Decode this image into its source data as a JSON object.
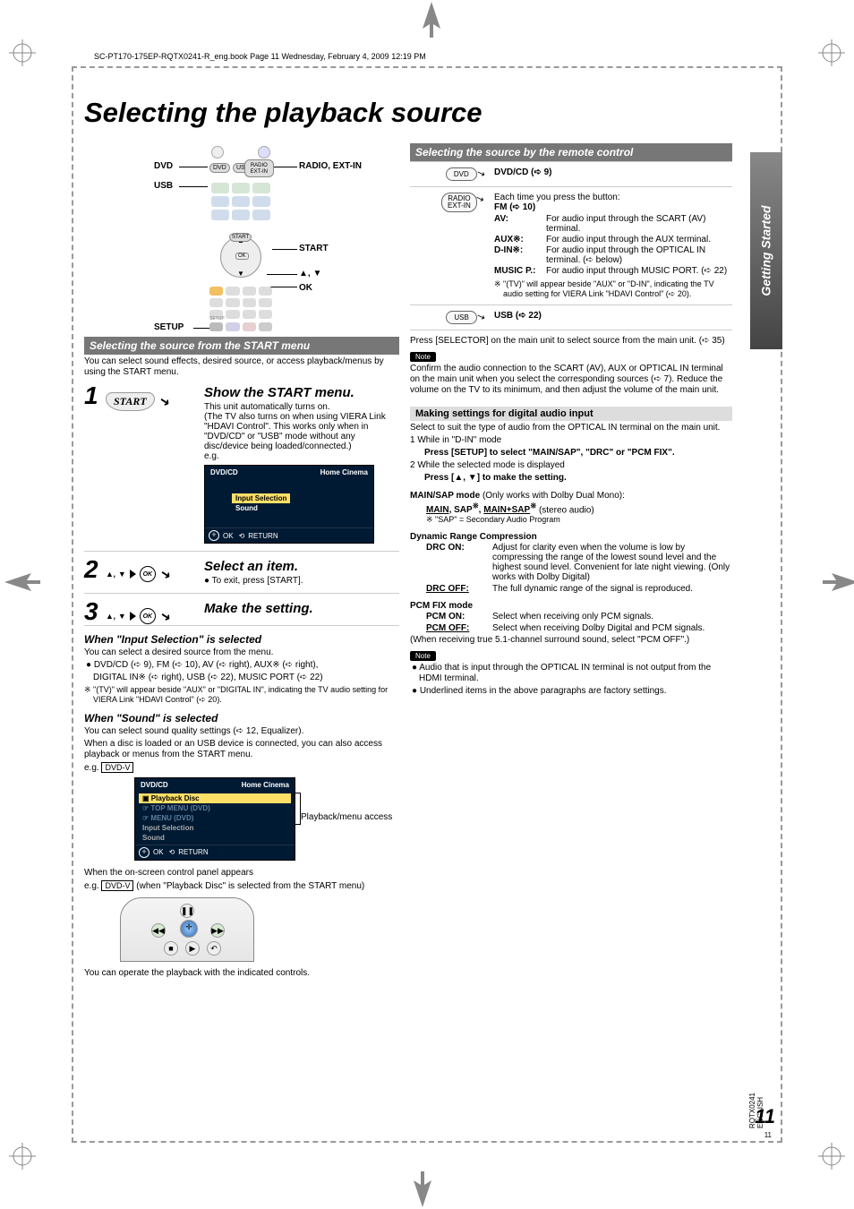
{
  "header_info": "SC-PT170-175EP-RQTX0241-R_eng.book  Page 11  Wednesday, February 4, 2009  12:19 PM",
  "page_title": "Selecting the playback source",
  "side_tab": "Getting Started",
  "remote_labels": {
    "dvd": "DVD",
    "usb": "USB",
    "radio_extin": "RADIO, EXT-IN",
    "start": "START",
    "updown": "▲, ▼",
    "ok": "OK",
    "setup": "SETUP",
    "btns": {
      "dvd": "DVD",
      "usb": "USB",
      "radio": "RADIO",
      "extin": "EXT-IN",
      "start": "START",
      "ok": "OK",
      "setup": "SETUP"
    }
  },
  "left": {
    "bar": "Selecting the source from the START menu",
    "intro": "You can select sound effects, desired source, or access playback/menus by using the START menu.",
    "step1": {
      "title": "Show the START menu.",
      "desc": "This unit automatically turns on.\n(The TV also turns on when using VIERA Link \"HDAVI Control\". This works only when in \"DVD/CD\" or \"USB\" mode without any disc/device being loaded/connected.)\ne.g.",
      "screen": {
        "dvdcd": "DVD/CD",
        "hc": "Home Cinema",
        "sel": "Input Selection",
        "sound": "Sound",
        "ok": "OK",
        "ret": "RETURN"
      }
    },
    "step2": {
      "icons": "▲, ▼",
      "ok": "OK",
      "title": "Select an item.",
      "desc": "● To exit, press [START]."
    },
    "step3": {
      "icons": "▲, ▼",
      "ok": "OK",
      "title": "Make the setting."
    },
    "input_sel": {
      "head": "When \"Input Selection\" is selected",
      "p1": "You can select a desired source from the menu.",
      "b1": "DVD/CD (➪ 9), FM (➪ 10), AV (➪ right), AUX※ (➪ right),",
      "b2": "DIGITAL IN※ (➪ right), USB (➪ 22), MUSIC PORT (➪ 22)",
      "fn": "※    \"(TV)\" will appear beside \"AUX\" or \"DIGITAL IN\", indicating the TV audio setting for VIERA Link \"HDAVI Control\" (➪ 20)."
    },
    "sound": {
      "head": "When \"Sound\" is selected",
      "p1": "You can select sound quality settings (➪ 12, Equalizer).",
      "p2": "When a disc is loaded or an USB device is connected, you can also access playback or menus from the START menu.",
      "eg": "e.g.",
      "badge": "DVD-V",
      "screen": {
        "dvdcd": "DVD/CD",
        "hc": "Home Cinema",
        "pb": "Playback Disc",
        "t1": "TOP MENU (DVD)",
        "t2": "MENU (DVD)",
        "is": "Input Selection",
        "snd": "Sound",
        "ok": "OK",
        "ret": "RETURN"
      },
      "pbmenu": "Playback/menu access"
    },
    "panel": {
      "p1": "When the on-screen control panel appears",
      "p2": "e.g.",
      "badge": "DVD-V",
      "p2b": " (when \"Playback Disc\" is selected from the START menu)",
      "p3": "You can operate the playback with the indicated controls."
    }
  },
  "right": {
    "bar": "Selecting the source by the remote control",
    "rows": {
      "dvd": {
        "btn": "DVD",
        "txt": "DVD/CD (➪ 9)"
      },
      "radio": {
        "btn_top": "RADIO",
        "btn_bot": "EXT-IN",
        "lead": "Each time you press the button:",
        "fm": "FM (➪ 10)",
        "av_k": "AV:",
        "av_v": "For audio input through the SCART (AV) terminal.",
        "aux_k": "AUX※:",
        "aux_v": "For audio input through the AUX terminal.",
        "din_k": "D-IN※:",
        "din_v": "For audio input through the OPTICAL IN terminal. (➪ below)",
        "mp_k": "MUSIC P.:",
        "mp_v": "For audio input through MUSIC PORT. (➪ 22)",
        "fn": "※    \"(TV)\" will appear beside \"AUX\" or \"D-IN\", indicating the TV audio setting for VIERA Link \"HDAVI Control\" (➪ 20)."
      },
      "usb": {
        "btn": "USB",
        "txt": "USB (➪ 22)"
      }
    },
    "after": "Press [SELECTOR] on the main unit to select source from the main unit. (➪ 35)",
    "note1": {
      "label": "Note",
      "body": "Confirm the audio connection to the SCART (AV), AUX or OPTICAL IN terminal on the main unit when you select the corresponding sources (➪ 7). Reduce the volume on the TV to its minimum, and then adjust the volume of the main unit."
    },
    "grey": "Making settings for digital audio input",
    "grey_p": "Select to suit the type of audio from the OPTICAL IN terminal on the main unit.",
    "s1a": "1   While in \"D-IN\" mode",
    "s1b": "Press [SETUP] to select \"MAIN/SAP\", \"DRC\" or \"PCM FIX\".",
    "s2a": "2   While the selected mode is displayed",
    "s2b": "Press [▲, ▼] to make the setting.",
    "msap_h": "MAIN/SAP mode",
    "msap_p": " (Only works with Dolby Dual Mono):",
    "msap_v": "MAIN, SAP※, MAIN+SAP※ (stereo audio)",
    "msap_fn": "※    \"SAP\" = Secondary Audio Program",
    "drc_h": "Dynamic Range Compression",
    "drc_on_k": "DRC ON:",
    "drc_on_v": "Adjust for clarity even when the volume is low by compressing the range of the lowest sound level and the highest sound level. Convenient for late night viewing. (Only works with Dolby Digital)",
    "drc_off_k": "DRC OFF:",
    "drc_off_v": "The full dynamic range of the signal is reproduced.",
    "pcm_h": "PCM FIX mode",
    "pcm_on_k": "PCM ON:",
    "pcm_on_v": "Select when receiving only PCM signals.",
    "pcm_off_k": "PCM OFF:",
    "pcm_off_v": "Select when receiving Dolby Digital and PCM signals.",
    "pcm_tail": "(When receiving true 5.1-channel surround sound, select \"PCM OFF\".)",
    "note2": {
      "label": "Note",
      "b1": "● Audio that is input through the OPTICAL IN terminal is not output from the HDMI terminal.",
      "b2": "● Underlined items in the above paragraphs are factory settings."
    }
  },
  "footer": {
    "big": "11",
    "code": "RQTX0241\nENGLISH",
    "small": "11"
  }
}
